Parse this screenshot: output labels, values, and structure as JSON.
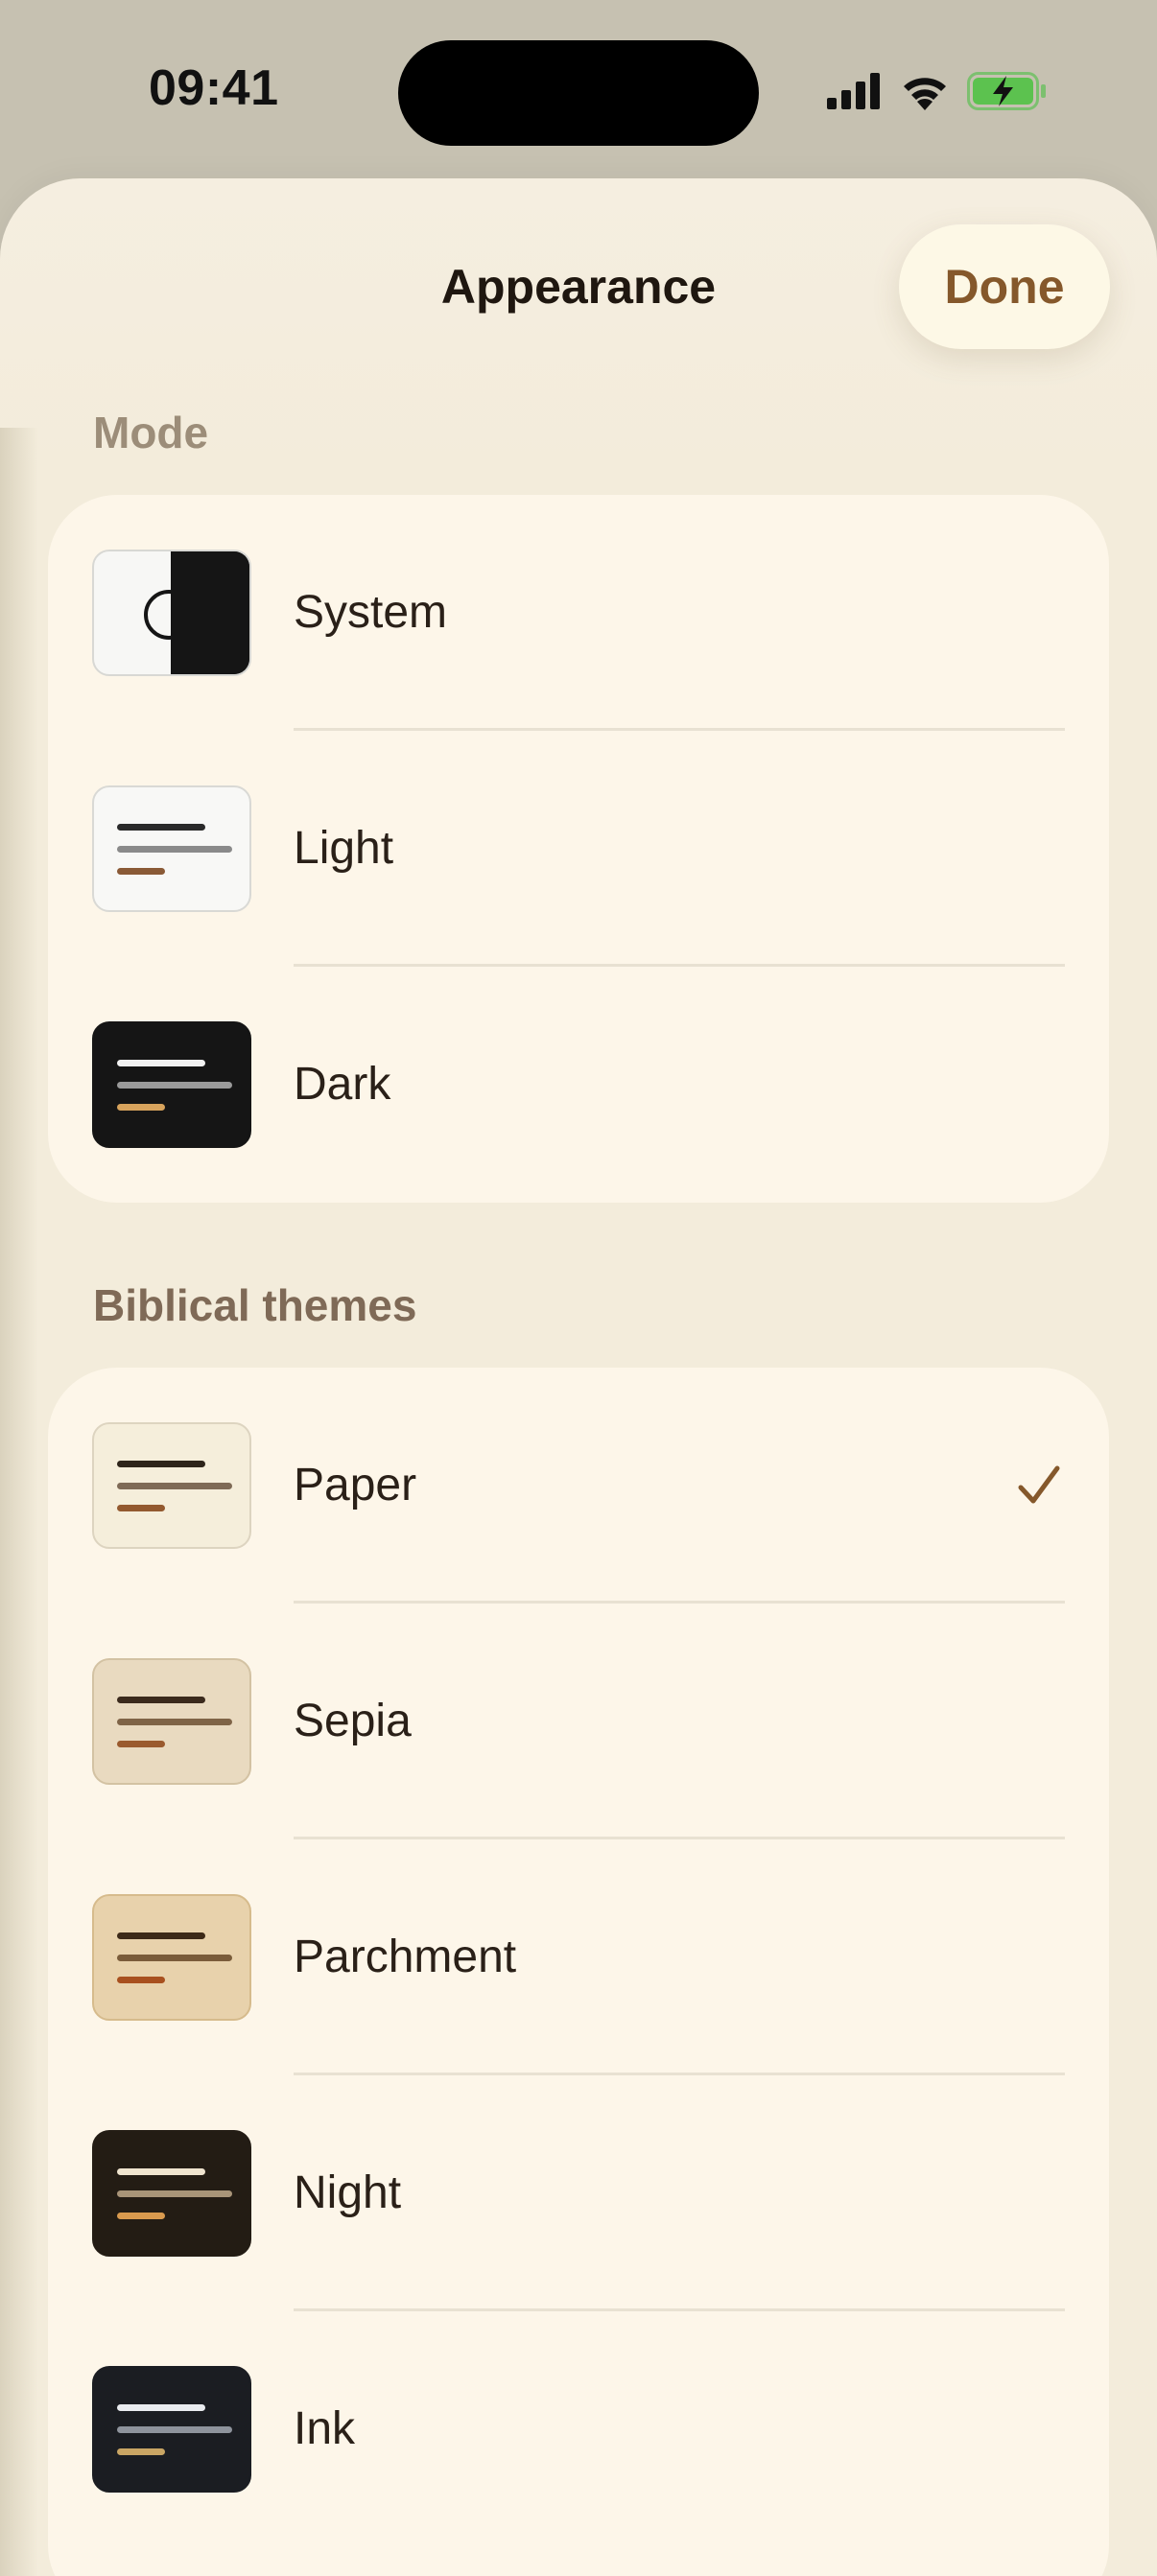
{
  "status_bar": {
    "time": "09:41"
  },
  "sheet": {
    "title": "Appearance",
    "done_label": "Done"
  },
  "sections": {
    "mode": {
      "label": "Mode",
      "items": [
        {
          "label": "System",
          "selected": false
        },
        {
          "label": "Light",
          "selected": false
        },
        {
          "label": "Dark",
          "selected": false
        }
      ]
    },
    "themes": {
      "label": "Biblical themes",
      "items": [
        {
          "label": "Paper",
          "selected": true
        },
        {
          "label": "Sepia",
          "selected": false
        },
        {
          "label": "Parchment",
          "selected": false
        },
        {
          "label": "Night",
          "selected": false
        },
        {
          "label": "Ink",
          "selected": false
        }
      ]
    }
  },
  "colors": {
    "accent": "#85582b",
    "sheet_background": "#f3ecdb",
    "group_background": "#fdf6e9",
    "section_label": "#9c8d79"
  },
  "icons": {
    "selected": "checkmark-icon",
    "battery": "battery-charging-icon",
    "wifi": "wifi-icon",
    "cellular": "cellular-signal-icon"
  }
}
